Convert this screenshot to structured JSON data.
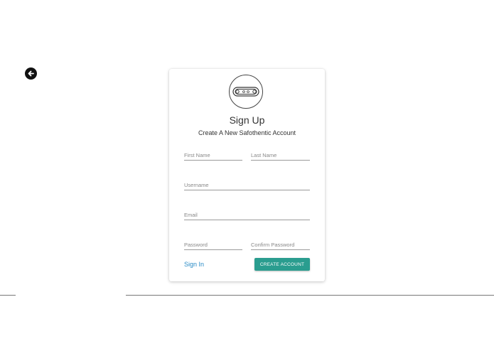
{
  "navigation": {
    "back_icon": "arrow-left-circle-icon"
  },
  "logo": {
    "icon": "chain-link-logo-icon"
  },
  "form": {
    "title": "Sign Up",
    "subtitle": "Create A New Safothentic Account",
    "fields": {
      "first_name": {
        "placeholder": "First Name",
        "value": ""
      },
      "last_name": {
        "placeholder": "Last Name",
        "value": ""
      },
      "username": {
        "placeholder": "Username",
        "value": ""
      },
      "email": {
        "placeholder": "Email",
        "value": ""
      },
      "password": {
        "placeholder": "Password",
        "value": ""
      },
      "confirm_password": {
        "placeholder": "Confirm Password",
        "value": ""
      }
    },
    "signin_link": "Sign In",
    "submit_label": "CREATE ACCOUNT"
  },
  "colors": {
    "accent": "#2a9d8f",
    "link": "#2a8bc6",
    "text": "#333333"
  }
}
